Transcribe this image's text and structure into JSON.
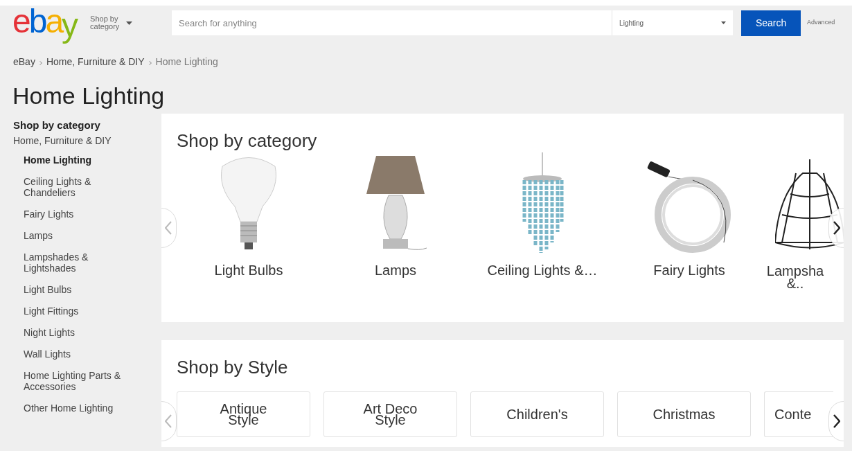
{
  "header": {
    "logo": [
      "e",
      "b",
      "a",
      "y"
    ],
    "shop_by_category": "Shop by category",
    "search": {
      "placeholder": "Search for anything"
    },
    "category_select": "Lighting",
    "search_button": "Search",
    "advanced": "Advanced"
  },
  "breadcrumb": [
    "eBay",
    "Home, Furniture & DIY",
    "Home Lighting"
  ],
  "title": "Home Lighting",
  "sidebar": {
    "heading": "Shop by category",
    "parent": "Home, Furniture & DIY",
    "items": [
      {
        "label": "Home Lighting",
        "selected": true
      },
      {
        "label": "Ceiling Lights & Chandeliers",
        "selected": false
      },
      {
        "label": "Fairy Lights",
        "selected": false
      },
      {
        "label": "Lamps",
        "selected": false
      },
      {
        "label": "Lampshades & Lightshades",
        "selected": false
      },
      {
        "label": "Light Bulbs",
        "selected": false
      },
      {
        "label": "Light Fittings",
        "selected": false
      },
      {
        "label": "Night Lights",
        "selected": false
      },
      {
        "label": "Wall Lights",
        "selected": false
      },
      {
        "label": "Home Lighting Parts & Accessories",
        "selected": false
      },
      {
        "label": "Other Home Lighting",
        "selected": false
      }
    ]
  },
  "shop_by_category": {
    "title": "Shop by category",
    "items": [
      "Light Bulbs",
      "Lamps",
      "Ceiling Lights &…",
      "Fairy Lights",
      "Lampsha &.."
    ]
  },
  "shop_by_style": {
    "title": "Shop by Style",
    "items": [
      "Antique Style",
      "Art Deco Style",
      "Children's",
      "Christmas",
      "Conte"
    ]
  }
}
